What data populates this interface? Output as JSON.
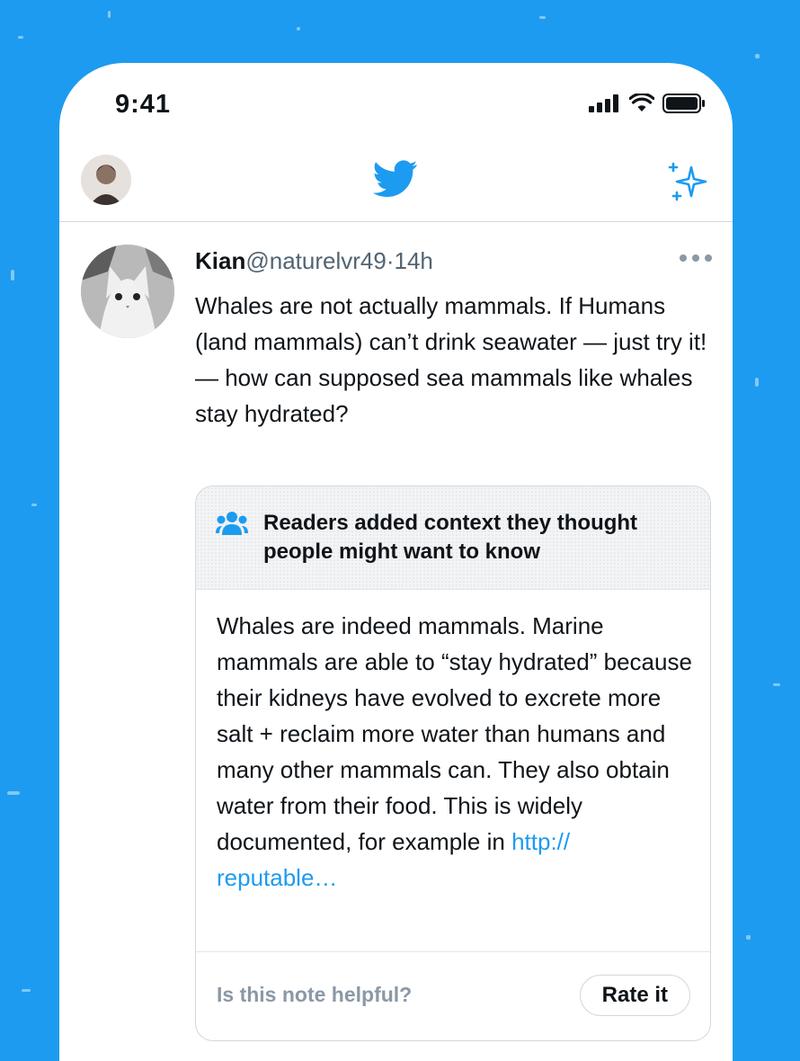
{
  "status_bar": {
    "time": "9:41"
  },
  "tweet": {
    "name": "Kian",
    "handle": "@naturelvr49",
    "separator": "·",
    "time": "14h",
    "text": "Whales are not actually mammals. If Humans (land mammals) can’t drink seawater — just try it! — how can supposed sea mammals like whales stay hydrated?"
  },
  "note": {
    "title": "Readers added context they thought people might want to know",
    "body": "Whales are indeed mammals. Marine mammals are able to “stay hydrated” because their kidneys have evolved to excrete more salt + reclaim more water than humans and many other mammals can. They also obtain water from their food. This is widely documented, for example in ",
    "link": "http:// reputable…",
    "question": "Is this note helpful?",
    "rate_label": "Rate it"
  },
  "icons": {
    "app_logo": "twitter-bird-icon",
    "top_right": "sparkle-icon",
    "note_icon": "people-icon",
    "more": "more-icon",
    "status": [
      "signal-icon",
      "wifi-icon",
      "battery-icon"
    ]
  },
  "colors": {
    "background": "#1d9bf0",
    "accent": "#1d9bf0",
    "text": "#0f1419",
    "muted": "#536471"
  }
}
